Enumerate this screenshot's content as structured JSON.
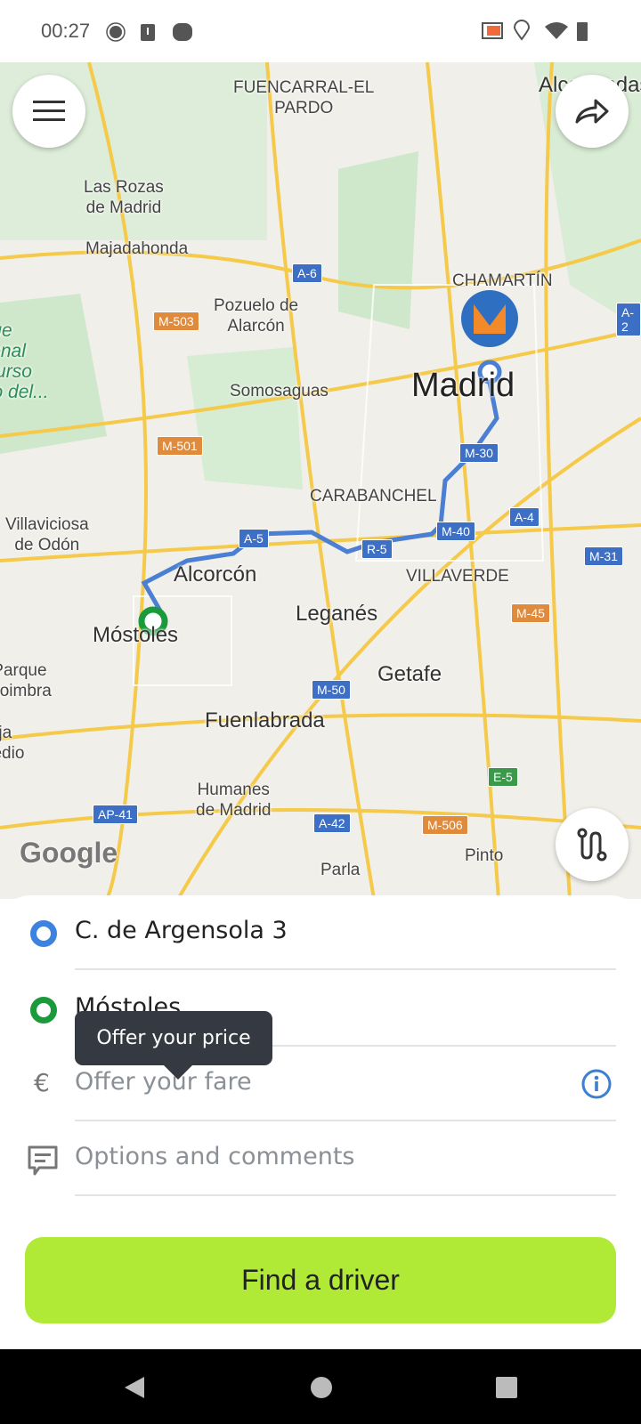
{
  "status_bar": {
    "time": "00:27",
    "icons_left": [
      "gps-icon",
      "sim-alert-icon",
      "app-icon"
    ],
    "icons_right": [
      "cast-icon",
      "location-icon",
      "wifi-icon",
      "battery-icon"
    ]
  },
  "map": {
    "labels": [
      "FUENCARRAL-EL\nPARDO",
      "Alcobendas",
      "Las Rozas\nde Madrid",
      "Majadahonda",
      "Pozuelo de\nAlarcón",
      "CHAMARTÍN",
      "Somosaguas",
      "Madrid",
      "CARABANCHEL",
      "Villaviciosa\nde Odón",
      "Alcorcón",
      "VILLAVERDE",
      "Leganés",
      "Móstoles",
      "Getafe",
      "Parque\nCoimbra",
      "Fuenlabrada",
      "Moraleja\nde Enmedio",
      "Humanes\nde Madrid",
      "Parla",
      "Pinto",
      "Parque\nRegional\ndel Curso\nMedio del..."
    ],
    "roads": [
      "A-6",
      "M-503",
      "A-2",
      "M-30",
      "M-501",
      "A-4",
      "A-5",
      "R-5",
      "M-40",
      "M-31",
      "M-45",
      "M-50",
      "E-5",
      "AP-41",
      "A-42",
      "M-506"
    ],
    "attribution": "Google",
    "route_color": "#4a7fd4"
  },
  "buttons": {
    "menu": "menu-icon",
    "share": "share-icon",
    "route": "route-icon"
  },
  "form": {
    "pickup": "C. de Argensola 3",
    "destination": "Móstoles",
    "tooltip": "Offer your price",
    "currency": "€",
    "fare_placeholder": "Offer your fare",
    "options_placeholder": "Options and comments",
    "find_button": "Find a driver"
  },
  "colors": {
    "accent": "#b0ea36",
    "pickup": "#3d82de",
    "destination": "#1a9a3a"
  }
}
